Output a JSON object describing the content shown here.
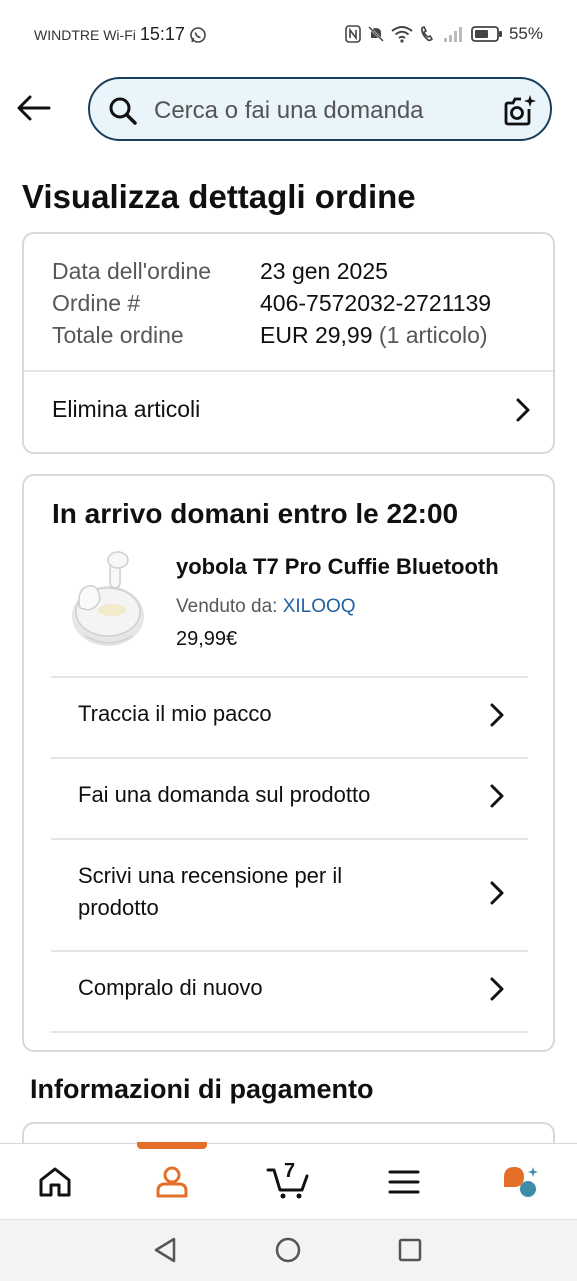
{
  "status_bar": {
    "carrier": "WINDTRE Wi-Fi",
    "time": "15:17",
    "battery": "55%",
    "icons": [
      "whatsapp-icon",
      "nfc-icon",
      "mute-icon",
      "wifi-icon",
      "wifi-call-icon",
      "signal-icon",
      "battery-icon"
    ]
  },
  "header": {
    "search_placeholder": "Cerca o fai una domanda"
  },
  "page": {
    "title": "Visualizza dettagli ordine"
  },
  "order_summary": {
    "date_label": "Data dell'ordine",
    "date_value": "23 gen 2025",
    "number_label": "Ordine #",
    "number_value": "406-7572032-2721139",
    "total_label": "Totale ordine",
    "total_value": "EUR 29,99",
    "total_items": "(1 articolo)",
    "delete_items": "Elimina articoli"
  },
  "shipment": {
    "arrival": "In arrivo domani entro le 22:00",
    "product_name": "yobola T7 Pro Cuffie Bluetooth",
    "sold_by_label": "Venduto da:",
    "seller": "XILOOQ",
    "price": "29,99€",
    "actions": [
      "Traccia il mio pacco",
      "Fai una domanda sul prodotto",
      "Scrivi una recensione per il prodotto",
      "Compralo di nuovo"
    ]
  },
  "payment": {
    "title": "Informazioni di pagamento"
  },
  "bottom_nav": {
    "cart_count": "7",
    "items": [
      "home-icon",
      "account-icon",
      "cart-icon",
      "menu-icon",
      "rufus-icon"
    ],
    "active": "account-icon",
    "accent": "#e46f2b"
  }
}
